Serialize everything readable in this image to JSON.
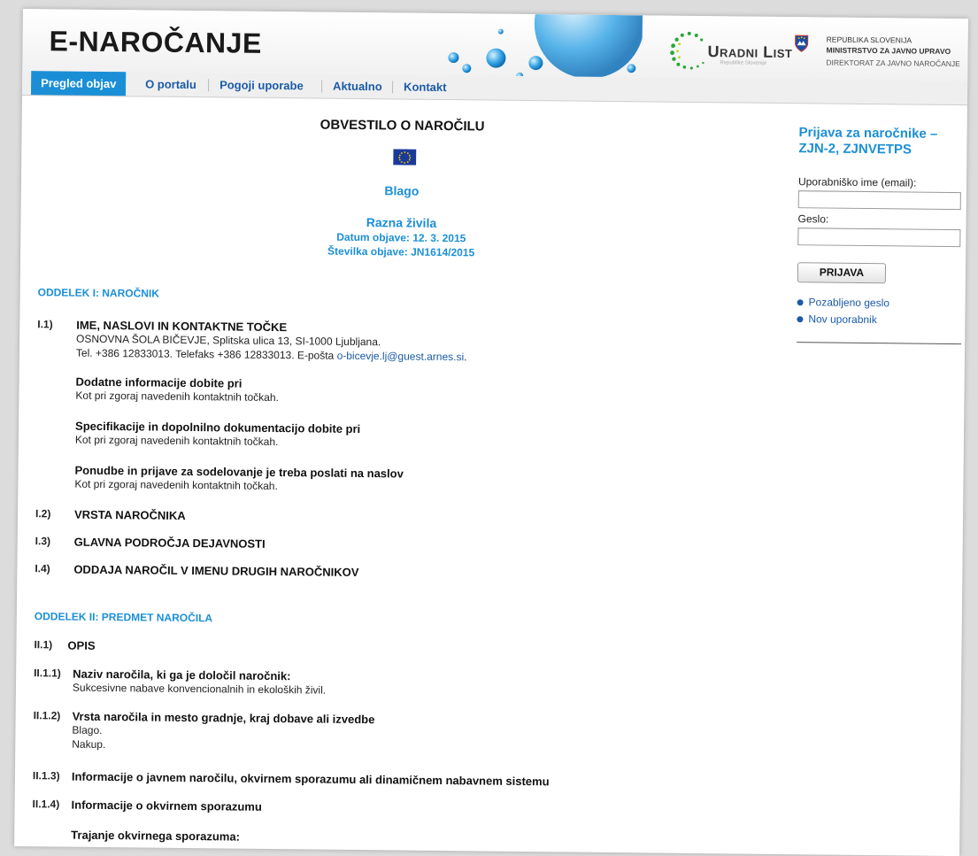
{
  "header": {
    "logo": "E-NAROČANJE",
    "uradni_list": "Uradni List",
    "uradni_list_sub": "Republike Slovenije",
    "gov_line1": "REPUBLIKA SLOVENIJA",
    "gov_line2": "MINISTRSTVO ZA JAVNO UPRAVO",
    "gov_line3": "DIREKTORAT ZA JAVNO NAROČANJE"
  },
  "nav": {
    "items": [
      {
        "label": "Pregled objav",
        "active": true
      },
      {
        "label": "O portalu"
      },
      {
        "label": "Pogoji uporabe"
      },
      {
        "label": "Aktualno"
      },
      {
        "label": "Kontakt"
      }
    ]
  },
  "notice": {
    "title": "OBVESTILO O NAROČILU",
    "kind": "Blago",
    "subject": "Razna živila",
    "date": "Datum objave: 12. 3. 2015",
    "number": "Številka objave: JN1614/2015"
  },
  "section1": {
    "heading": "ODDELEK I: NAROČNIK",
    "i1_num": "I.1)",
    "i1_title": "IME, NASLOVI IN KONTAKTNE TOČKE",
    "i1_address": "OSNOVNA ŠOLA BIČEVJE, Splitska ulica 13, SI-1000 Ljubljana.",
    "i1_contact": "Tel. +386 12833013. Telefaks +386 12833013. E-pošta ",
    "i1_email": "o-bicevje.lj@guest.arnes.si",
    "i1_email_end": ".",
    "add_title": "Dodatne informacije dobite pri",
    "add_text": "Kot pri zgoraj navedenih kontaktnih točkah.",
    "spec_title": "Specifikacije in dopolnilno dokumentacijo dobite pri",
    "spec_text": "Kot pri zgoraj navedenih kontaktnih točkah.",
    "offer_title": "Ponudbe in prijave za sodelovanje je treba poslati na naslov",
    "offer_text": "Kot pri zgoraj navedenih kontaktnih točkah.",
    "i2_num": "I.2)",
    "i2_title": "VRSTA NAROČNIKA",
    "i3_num": "I.3)",
    "i3_title": "GLAVNA PODROČJA DEJAVNOSTI",
    "i4_num": "I.4)",
    "i4_title": "ODDAJA NAROČIL V IMENU DRUGIH NAROČNIKOV"
  },
  "section2": {
    "heading": "ODDELEK II: PREDMET NAROČILA",
    "ii1_num": "II.1)",
    "ii1_title": "OPIS",
    "ii11_num": "II.1.1)",
    "ii11_title": "Naziv naročila, ki ga je določil naročnik:",
    "ii11_text": "Sukcesivne nabave konvencionalnih in ekoloških živil.",
    "ii12_num": "II.1.2)",
    "ii12_title": "Vrsta naročila in mesto gradnje, kraj dobave ali izvedbe",
    "ii12_text1": "Blago.",
    "ii12_text2": "Nakup.",
    "ii13_num": "II.1.3)",
    "ii13_title": "Informacije o javnem naročilu, okvirnem sporazumu ali dinamičnem nabavnem sistemu",
    "ii14_num": "II.1.4)",
    "ii14_title": "Informacije o okvirnem sporazumu",
    "duration_title": "Trajanje okvirnega sporazuma:"
  },
  "sidebar": {
    "title": "Prijava za naročnike – ZJN-2, ZJNVETPS",
    "username_label": "Uporabniško ime (email):",
    "password_label": "Geslo:",
    "login_button": "PRIJAVA",
    "forgot_link": "Pozabljeno geslo",
    "new_user_link": "Nov uporabnik"
  },
  "colors": {
    "accent": "#1b8fd6",
    "link": "#1a5aa6",
    "eu_flag": "#1a3a9a",
    "eu_stars": "#ffcc00"
  }
}
